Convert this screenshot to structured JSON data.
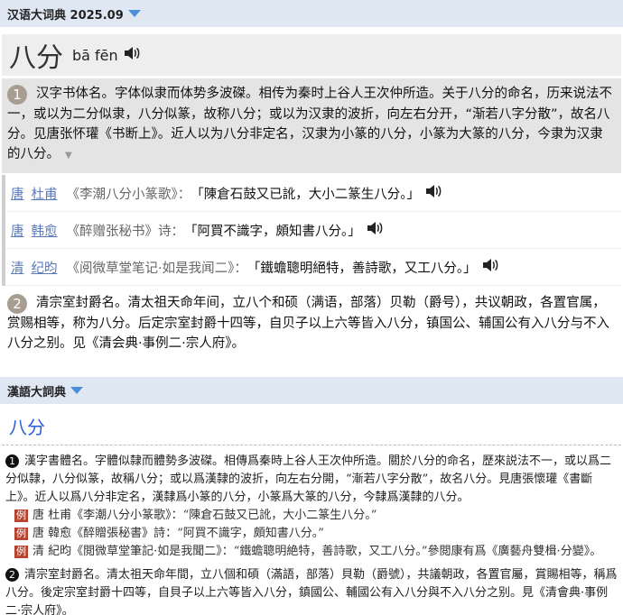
{
  "dict1": {
    "title": "汉语大词典 2025.09",
    "word": "八分",
    "pinyin": "bā fēn",
    "sense1": {
      "num": "1",
      "text": "汉字书体名。字体似隶而体势多波磔。相传为秦时上谷人王次仲所造。关于八分的命名，历来说法不一，或以为二分似隶，八分似篆，故称八分；或以为汉隶的波折，向左右分开，“渐若八字分散”，故名八分。见唐张怀瓘《书断上》。近人以为八分非定名，汉隶为小篆的八分，小篆为大篆的八分，今隶为汉隶的八分。",
      "more": "▼"
    },
    "quotes": [
      {
        "dynasty": "唐",
        "author": "杜甫",
        "source": "《李潮八分小篆歌》：",
        "text": "「陳倉石鼓又已訛，大小二篆生八分。」"
      },
      {
        "dynasty": "唐",
        "author": "韩愈",
        "source": "《醉赠张秘书》诗：",
        "text": "「阿買不識字，頗知書八分。」"
      },
      {
        "dynasty": "清",
        "author": "纪昀",
        "source": "《阅微草堂笔记·如是我闻二》：",
        "text": "「鐵蟾聰明絕特，善詩歌，又工八分。」"
      }
    ],
    "sense2": {
      "num": "2",
      "text": "清宗室封爵名。清太祖天命年间，立八个和硕（满语，部落）贝勒（爵号），共议朝政，各置官属，赏赐相等，称为八分。后定宗室封爵十四等，自贝子以上六等皆入八分，镇国公、辅国公有入八分与不入八分之别。见《清会典·事例二·宗人府》。"
    }
  },
  "dict2": {
    "title": "漢語大詞典",
    "word": "八分",
    "sense1_num": "1",
    "sense1_text": "漢字書體名。字體似隸而體勢多波磔。相傳爲秦時上谷人王次仲所造。關於八分的命名，歷來説法不一，或以爲二分似隸，八分似篆，故稱八分；或以爲漢隸的波折，向左右分開，“漸若八字分散”，故名八分。見唐張懷瓘《書斷上》。近人以爲八分非定名，漢隸爲小篆的八分，小篆爲大篆的八分，今隸爲漢隸的八分。",
    "example_tag": "例",
    "examples": [
      "唐 杜甫《李潮八分小篆歌》：“陳倉石鼓又已訛，大小二篆生八分。”",
      "唐 韓愈《醉贈張秘書》詩：“阿買不識字，頗知書八分。”",
      "清 紀昀《閲微草堂筆記·如是我聞二》：“鐵蟾聰明絶特，善詩歌，又工八分。”參閲康有爲《廣藝舟雙楫·分變》。"
    ],
    "sense2_num": "2",
    "sense2_text": "清宗室封爵名。清太祖天命年間，立八個和碩（滿語，部落）貝勒（爵號），共議朝政，各置官屬，賞賜相等，稱爲八分。後定宗室封爵十四等，自貝子以上六等皆入八分，鎮國公、輔國公有入八分與不入八分之别。見《清會典·事例二·宗人府》。"
  },
  "colors": {
    "accent": "#4a90d9",
    "link": "#5b7bb8",
    "tag": "#b5432e",
    "header_bg": "#dfe7f3"
  },
  "icons": [
    "caret-down-icon",
    "speaker-icon"
  ]
}
